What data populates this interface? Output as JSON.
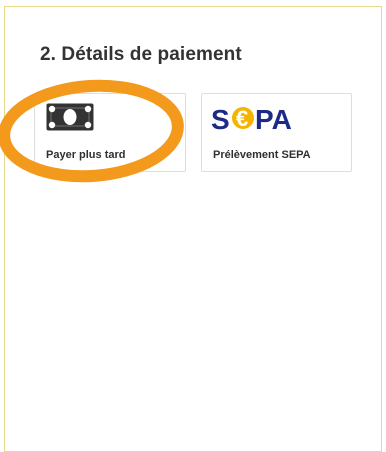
{
  "section": {
    "title": "2. Détails de paiement"
  },
  "payment_methods": [
    {
      "label": "Payer plus tard",
      "icon": "cash-icon",
      "highlighted": true
    },
    {
      "label": "Prélèvement SEPA",
      "icon": "sepa-logo",
      "logo_text": "SEPA"
    }
  ],
  "colors": {
    "highlight_ring": "#f39a1d",
    "sepa_navy": "#1d2a87",
    "sepa_euro_yellow": "#f5b400",
    "cash_icon": "#333333",
    "frame_border": "#e8d88a"
  }
}
